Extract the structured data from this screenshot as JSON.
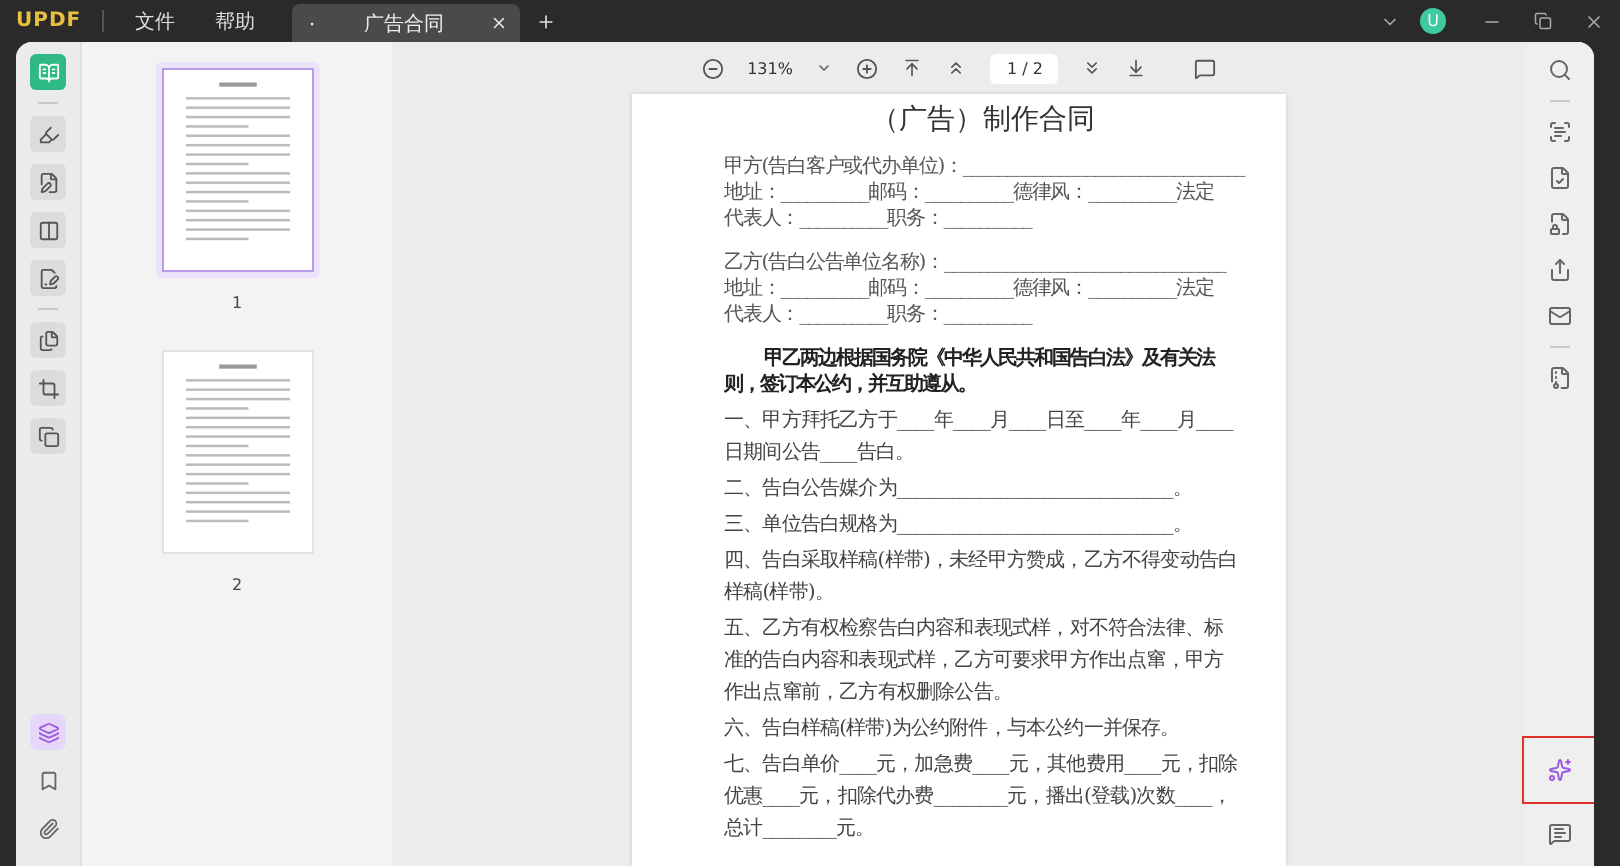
{
  "title_bar": {
    "logo": "UPDF",
    "menus": [
      "文件",
      "帮助"
    ],
    "tabs": [
      {
        "title": "广告合同",
        "selected": true
      }
    ],
    "avatar": "U"
  },
  "left_tools": [
    [
      {
        "kind": "reader",
        "selected": true
      }
    ],
    [
      {
        "kind": "comment",
        "selected": false
      },
      {
        "kind": "edit",
        "selected": false
      },
      {
        "kind": "form",
        "selected": false
      },
      {
        "kind": "sign",
        "selected": false
      }
    ],
    [
      {
        "kind": "organize",
        "selected": false
      },
      {
        "kind": "crop",
        "selected": false
      },
      {
        "kind": "combine",
        "selected": false
      }
    ]
  ],
  "left_bottom_tools": [
    {
      "kind": "layers",
      "selected": true
    },
    {
      "kind": "bookmark",
      "selected": false
    },
    {
      "kind": "attachment",
      "selected": false
    }
  ],
  "thumbnails": [
    {
      "label": "1",
      "selected": true
    },
    {
      "label": "2",
      "selected": false
    }
  ],
  "toolbar": {
    "zoom": "131%",
    "page": "1 / 2"
  },
  "document": {
    "title": "（广告）制作合同",
    "parties": [
      {
        "lines": [
          "甲方(告白客户或代办单位)：________________________________",
          "地址：__________邮码：__________德律风：__________法定",
          "代表人：__________职务：__________"
        ]
      },
      {
        "lines": [
          "乙方(告白公告单位名称)：________________________________",
          "地址：__________邮码：__________德律风：__________法定",
          "代表人：__________职务：__________"
        ]
      }
    ],
    "preamble": "甲乙两边根据国务院《中华人民共和国告白法》及有关法则，签订本公约，并互助遵从。",
    "clauses": [
      "一、甲方拜托乙方于____年____月____日至____年____月____日期间公告____告白。",
      "二、告白公告媒介为______________________________。",
      "三、单位告白规格为______________________________。",
      "四、告白采取样稿(样带)，未经甲方赞成，乙方不得变动告白样稿(样带)。",
      "五、乙方有权检察告白内容和表现式样，对不符合法律、标准的告白内容和表现式样，乙方可要求甲方作出点窜，甲方作出点窜前，乙方有权删除公告。",
      "六、告白样稿(样带)为公约附件，与本公约一并保存。",
      "七、告白单价____元，加急费____元，其他费用____元，扣除优惠____元，扣除代办费________元，播出(登载)次数____，总计________元。"
    ]
  },
  "right_tools": [
    [
      {
        "kind": "search",
        "highlighted": false
      }
    ],
    [
      {
        "kind": "ocr",
        "highlighted": false
      },
      {
        "kind": "convert",
        "highlighted": false
      },
      {
        "kind": "protect",
        "highlighted": false
      },
      {
        "kind": "share",
        "highlighted": false
      },
      {
        "kind": "mail",
        "highlighted": false
      }
    ],
    [
      {
        "kind": "compress",
        "highlighted": false
      }
    ]
  ],
  "right_bottom_tools": [
    {
      "kind": "ai",
      "highlighted": true
    },
    {
      "kind": "comments",
      "highlighted": false
    }
  ]
}
